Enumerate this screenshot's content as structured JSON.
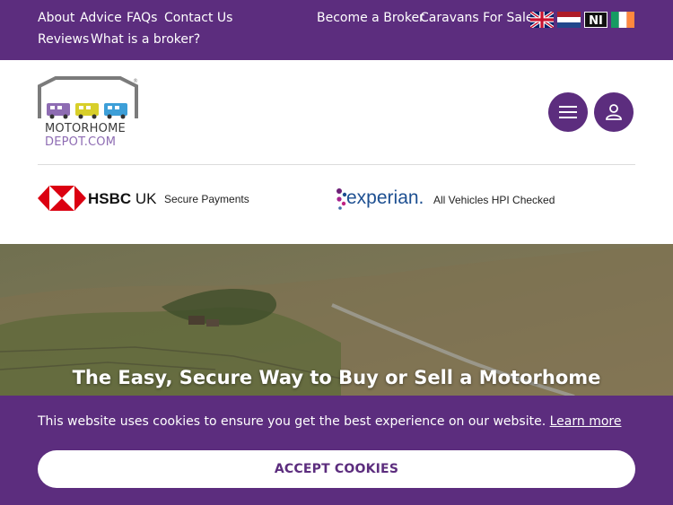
{
  "topnav": {
    "about": "About",
    "advice": "Advice",
    "faqs": "FAQs",
    "contact": "Contact Us",
    "reviews": "Reviews",
    "what_is_broker": "What is a broker?",
    "become_broker": "Become a Broker",
    "caravans": "Caravans For Sale",
    "flags": [
      "uk-flag-icon",
      "netherlands-flag-icon",
      "northern-ireland-flag-icon",
      "ireland-flag-icon"
    ],
    "ni_label": "NI"
  },
  "header": {
    "logo_line1": "MOTORHOME",
    "logo_line2": "DEPOT.COM",
    "menu_icon": "hamburger-menu-icon",
    "account_icon": "user-account-icon"
  },
  "trust": {
    "hsbc_brand": "HSBC",
    "hsbc_region": "UK",
    "hsbc_caption": "Secure Payments",
    "experian_brand": "experian.",
    "experian_caption": "All Vehicles HPI Checked"
  },
  "hero": {
    "title": "The Easy, Secure Way to Buy or Sell a Motorhome"
  },
  "cookie": {
    "message": "This website uses cookies to ensure you get the best experience on our website.",
    "learn_more": "Learn more",
    "accept": "ACCEPT COOKIES"
  },
  "colors": {
    "brand_purple": "#5c2d7e",
    "hsbc_red": "#db0011",
    "experian_blue": "#1d4f91",
    "experian_magenta": "#a6228f"
  }
}
